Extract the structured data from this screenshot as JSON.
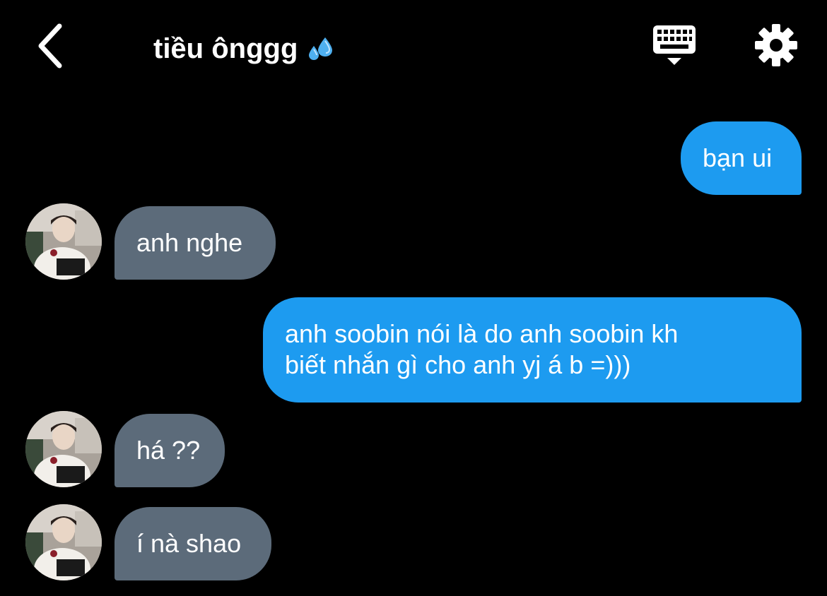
{
  "header": {
    "title": "tiều ônggg",
    "title_emoji": "sweat-droplets-emoji",
    "back_icon": "chevron-left-icon",
    "keyboard_icon": "keyboard-icon",
    "settings_icon": "gear-icon"
  },
  "colors": {
    "background": "#000000",
    "outgoing_bubble": "#1d9bf0",
    "incoming_bubble": "#5c6b7a",
    "text": "#ffffff"
  },
  "messages": [
    {
      "direction": "outgoing",
      "lines": [
        "bạn ui"
      ]
    },
    {
      "direction": "incoming",
      "lines": [
        "anh nghe"
      ],
      "avatar": "avatar"
    },
    {
      "direction": "outgoing",
      "lines": [
        "anh soobin nói là do anh soobin kh",
        "biết nhắn gì cho anh yj á b =)))"
      ]
    },
    {
      "direction": "incoming",
      "lines": [
        "há ??"
      ],
      "avatar": "avatar"
    },
    {
      "direction": "incoming",
      "lines": [
        "í nà shao"
      ],
      "avatar": "avatar"
    }
  ]
}
